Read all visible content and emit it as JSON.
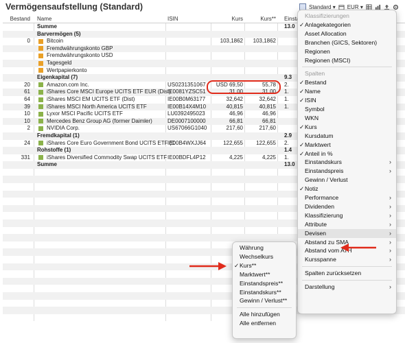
{
  "page": {
    "title": "Vermögensaufstellung (Standard)"
  },
  "toolbar": {
    "view": "Standard ▾",
    "currency": "EUR ▾"
  },
  "columns": {
    "bestand": "Bestand",
    "name": "Name",
    "isin": "ISIN",
    "kurs": "Kurs",
    "kurs2": "Kurs**",
    "einstand": "Einstand"
  },
  "rows": [
    {
      "bestand": "",
      "name": "Summe",
      "isin": "",
      "kurs": "",
      "kurs2": "",
      "einstand": "13.0",
      "bold": true
    },
    {
      "bestand": "",
      "name": "Barvermögen (5)",
      "isin": "",
      "kurs": "",
      "kurs2": "",
      "einstand": "",
      "bold": true
    },
    {
      "bestand": "0",
      "name": "Bitcoin",
      "isin": "",
      "kurs": "103,1862",
      "kurs2": "103,1862",
      "einstand": "",
      "icon": "orange"
    },
    {
      "bestand": "",
      "name": "Fremdwährungskonto GBP",
      "isin": "",
      "kurs": "",
      "kurs2": "",
      "einstand": "",
      "icon": "orange"
    },
    {
      "bestand": "",
      "name": "Fremdwährungskonto USD",
      "isin": "",
      "kurs": "",
      "kurs2": "",
      "einstand": "",
      "icon": "orange"
    },
    {
      "bestand": "",
      "name": "Tagesgeld",
      "isin": "",
      "kurs": "",
      "kurs2": "",
      "einstand": "",
      "icon": "orange"
    },
    {
      "bestand": "",
      "name": "Wertpapierkonto",
      "isin": "",
      "kurs": "",
      "kurs2": "",
      "einstand": "",
      "icon": "orange"
    },
    {
      "bestand": "",
      "name": "Eigenkapital (7)",
      "isin": "",
      "kurs": "",
      "kurs2": "",
      "einstand": "9.3",
      "bold": true
    },
    {
      "bestand": "20",
      "name": "Amazon.com Inc.",
      "isin": "US0231351067",
      "kurs": "USD 69,50",
      "kurs2": "55,78",
      "einstand": "2.",
      "icon": "green"
    },
    {
      "bestand": "61",
      "name": "iShares Core MSCI Europe UCITS ETF EUR (Dist)",
      "isin": "IE0081YZSC51",
      "kurs": "31,00",
      "kurs2": "31,00",
      "einstand": "1.",
      "icon": "green"
    },
    {
      "bestand": "64",
      "name": "iShares MSCI EM UCITS ETF (Dist)",
      "isin": "IE00B0M63177",
      "kurs": "32,642",
      "kurs2": "32,642",
      "einstand": "1.",
      "icon": "green"
    },
    {
      "bestand": "39",
      "name": "iShares MSCI North America UCITS ETF",
      "isin": "IE00B14X4M10",
      "kurs": "40,815",
      "kurs2": "40,815",
      "einstand": "1.",
      "icon": "green"
    },
    {
      "bestand": "10",
      "name": "Lyxor MSCI Pacific UCITS ETF",
      "isin": "LU0392495023",
      "kurs": "46,96",
      "kurs2": "46,96",
      "einstand": "",
      "icon": "green"
    },
    {
      "bestand": "10",
      "name": "Mercedes Benz Group AG (former Daimler)",
      "isin": "DE0007100000",
      "kurs": "66,81",
      "kurs2": "66,81",
      "einstand": "",
      "icon": "green"
    },
    {
      "bestand": "2",
      "name": "NVIDIA Corp.",
      "isin": "US67066G1040",
      "kurs": "217,60",
      "kurs2": "217,60",
      "einstand": "",
      "icon": "green"
    },
    {
      "bestand": "",
      "name": "Fremdkapital (1)",
      "isin": "",
      "kurs": "",
      "kurs2": "",
      "einstand": "2.9",
      "bold": true
    },
    {
      "bestand": "24",
      "name": "iShares Core Euro Government Bond UCITS ETF (Dist)",
      "isin": "IE00B4WXJJ64",
      "kurs": "122,655",
      "kurs2": "122,655",
      "einstand": "2.",
      "icon": "green"
    },
    {
      "bestand": "",
      "name": "Rohstoffe (1)",
      "isin": "",
      "kurs": "",
      "kurs2": "",
      "einstand": "1.4",
      "bold": true
    },
    {
      "bestand": "331",
      "name": "iShares Diversified Commodity Swap UCITS ETF",
      "isin": "IE00BDFL4P12",
      "kurs": "4,225",
      "kurs2": "4,225",
      "einstand": "1.",
      "icon": "green"
    },
    {
      "bestand": "",
      "name": "Summe",
      "isin": "",
      "kurs": "",
      "kurs2": "",
      "einstand": "13.0",
      "bold": true
    }
  ],
  "main_menu": {
    "items": [
      {
        "label": "Klassifizierungen",
        "kind": "header"
      },
      {
        "label": "Anlagekategorien",
        "check": true
      },
      {
        "label": "Asset Allocation"
      },
      {
        "label": "Branchen (GICS, Sektoren)"
      },
      {
        "label": "Regionen"
      },
      {
        "label": "Regionen (MSCI)"
      },
      {
        "kind": "sep"
      },
      {
        "label": "Spalten",
        "kind": "header"
      },
      {
        "label": "Bestand",
        "check": true
      },
      {
        "label": "Name",
        "check": true
      },
      {
        "label": "ISIN",
        "check": true
      },
      {
        "label": "Symbol"
      },
      {
        "label": "WKN"
      },
      {
        "label": "Kurs",
        "check": true
      },
      {
        "label": "Kursdatum"
      },
      {
        "label": "Marktwert",
        "check": true
      },
      {
        "label": "Anteil in %",
        "check": true
      },
      {
        "label": "Einstandskurs",
        "submenu": true
      },
      {
        "label": "Einstandspreis",
        "submenu": true
      },
      {
        "label": "Gewinn / Verlust"
      },
      {
        "label": "Notiz",
        "check": true
      },
      {
        "label": "Performance",
        "submenu": true
      },
      {
        "label": "Dividenden",
        "submenu": true
      },
      {
        "label": "Klassifizierung",
        "submenu": true
      },
      {
        "label": "Attribute",
        "submenu": true
      },
      {
        "label": "Devisen",
        "submenu": true,
        "selected": true
      },
      {
        "label": "Abstand zu SMA",
        "submenu": true
      },
      {
        "label": "Abstand vom ATH",
        "submenu": true
      },
      {
        "label": "Kursspanne",
        "submenu": true
      },
      {
        "kind": "sep"
      },
      {
        "label": "Spalten zurücksetzen"
      },
      {
        "kind": "sep"
      },
      {
        "label": "Darstellung",
        "submenu": true
      }
    ]
  },
  "sub_menu": {
    "items": [
      {
        "label": "Währung"
      },
      {
        "label": "Wechselkurs"
      },
      {
        "label": "Kurs**",
        "check": true
      },
      {
        "label": "Marktwert**"
      },
      {
        "label": "Einstandspreis**"
      },
      {
        "label": "Einstandskurs**"
      },
      {
        "label": "Gewinn / Verlust**"
      },
      {
        "kind": "sep"
      },
      {
        "label": "Alle hinzufügen"
      },
      {
        "label": "Alle entfernen"
      }
    ]
  },
  "colors": {
    "highlight": "#e02b1b",
    "equity_icon": "#8bb24a",
    "cash_icon": "#e9a028"
  }
}
